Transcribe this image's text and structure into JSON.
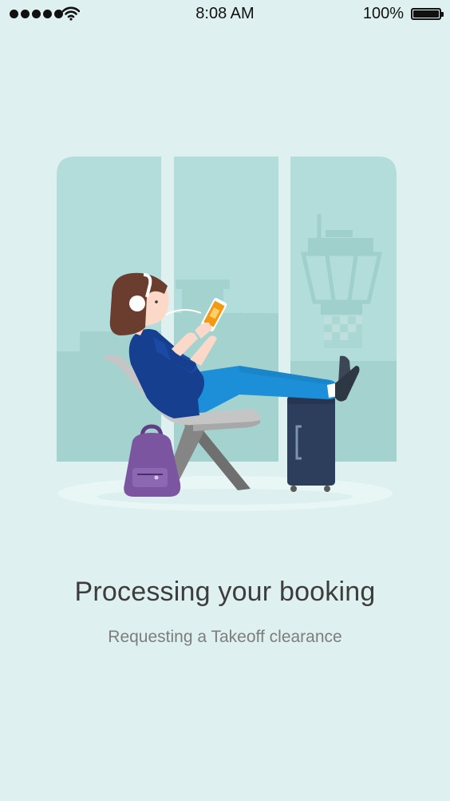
{
  "status_bar": {
    "time": "8:08 AM",
    "battery_percent": "100%",
    "signal_bars": 5,
    "wifi_icon": "wifi-icon",
    "battery_icon": "battery-full-icon"
  },
  "illustration": {
    "name": "traveler-waiting-at-airport-illustration",
    "colors": {
      "background": "#dff0f0",
      "window": "#b2ddda",
      "skyline": "#a4d3cf",
      "jacket": "#163f8f",
      "jeans": "#1d8fd8",
      "hair": "#6b3d2e",
      "phone_screen": "#f39a12",
      "backpack": "#7b55a0",
      "suitcase": "#2d3e5c",
      "chair": "#8a8a8a"
    }
  },
  "content": {
    "title": "Processing your booking",
    "subtitle": "Requesting a Takeoff clearance"
  }
}
